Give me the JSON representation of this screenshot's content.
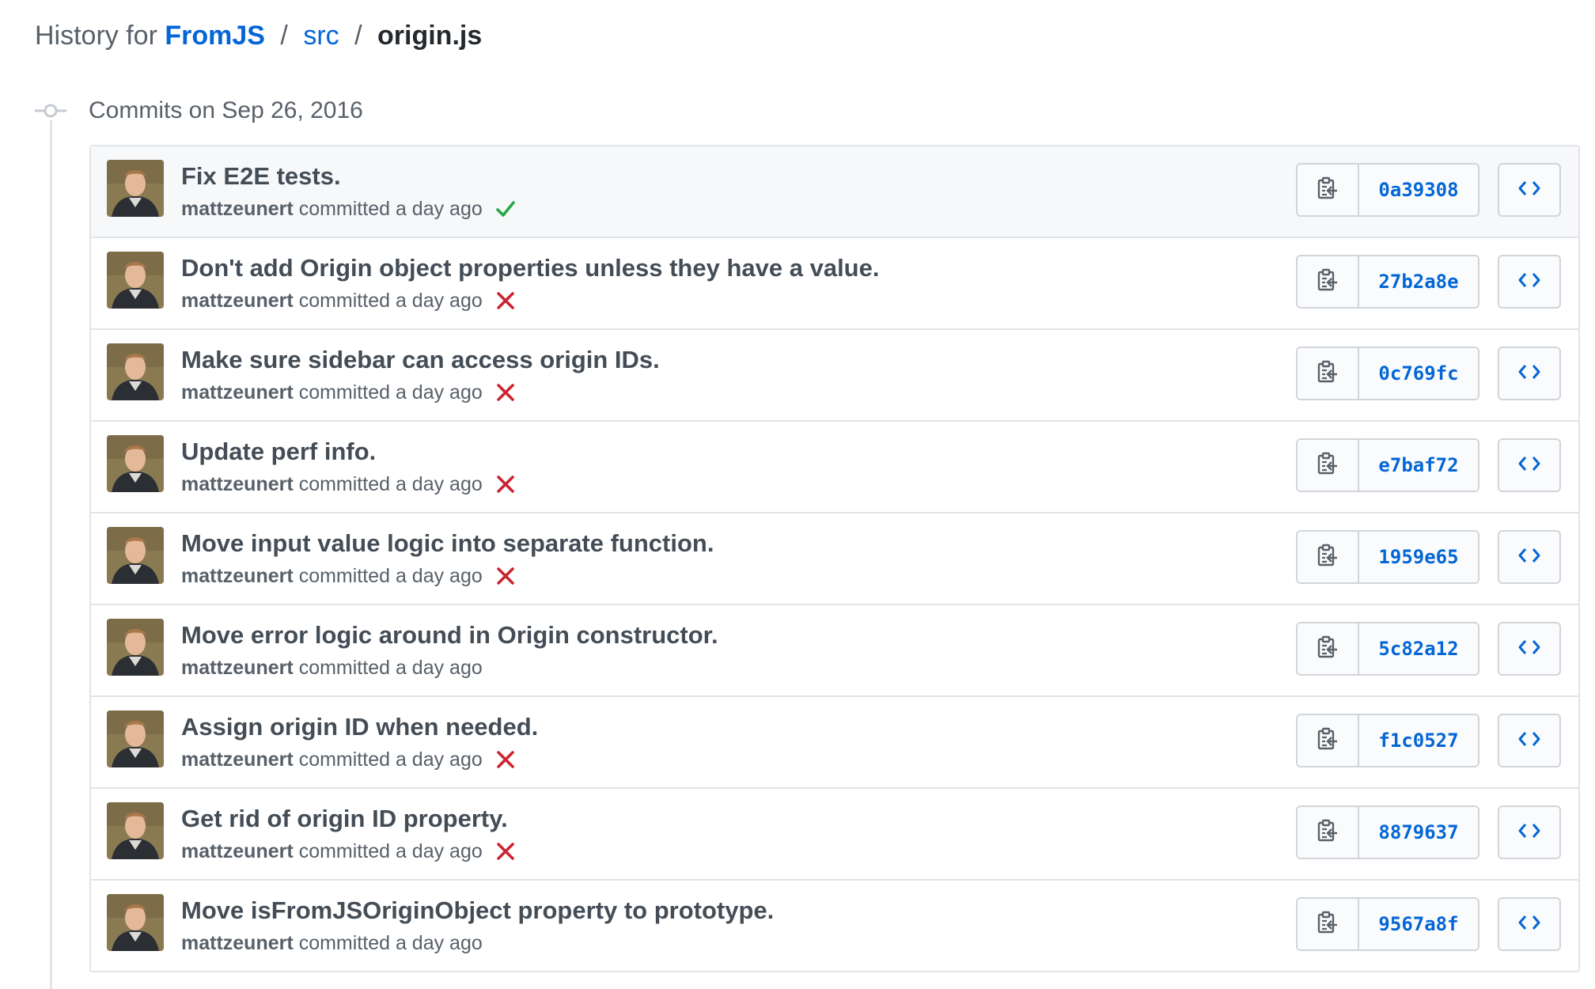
{
  "breadcrumb": {
    "prefix": "History for",
    "repo": "FromJS",
    "separator": "/",
    "directory": "src",
    "file": "origin.js"
  },
  "group": {
    "title": "Commits on Sep 26, 2016"
  },
  "colors": {
    "link": "#0366d6",
    "success": "#28a745",
    "failure": "#cb2431",
    "border": "#e1e4e8"
  },
  "icons": {
    "timeline": "git-commit-icon",
    "copy": "clippy-icon",
    "browse": "code-icon",
    "success": "check-icon",
    "failure": "x-icon"
  },
  "commits": [
    {
      "title": "Fix E2E tests.",
      "author": "mattzeunert",
      "committed": "committed a day ago",
      "status": "success",
      "sha": "0a39308"
    },
    {
      "title": "Don't add Origin object properties unless they have a value.",
      "author": "mattzeunert",
      "committed": "committed a day ago",
      "status": "failure",
      "sha": "27b2a8e"
    },
    {
      "title": "Make sure sidebar can access origin IDs.",
      "author": "mattzeunert",
      "committed": "committed a day ago",
      "status": "failure",
      "sha": "0c769fc"
    },
    {
      "title": "Update perf info.",
      "author": "mattzeunert",
      "committed": "committed a day ago",
      "status": "failure",
      "sha": "e7baf72"
    },
    {
      "title": "Move input value logic into separate function.",
      "author": "mattzeunert",
      "committed": "committed a day ago",
      "status": "failure",
      "sha": "1959e65"
    },
    {
      "title": "Move error logic around in Origin constructor.",
      "author": "mattzeunert",
      "committed": "committed a day ago",
      "status": "none",
      "sha": "5c82a12"
    },
    {
      "title": "Assign origin ID when needed.",
      "author": "mattzeunert",
      "committed": "committed a day ago",
      "status": "failure",
      "sha": "f1c0527"
    },
    {
      "title": "Get rid of origin ID property.",
      "author": "mattzeunert",
      "committed": "committed a day ago",
      "status": "failure",
      "sha": "8879637"
    },
    {
      "title": "Move isFromJSOriginObject property to prototype.",
      "author": "mattzeunert",
      "committed": "committed a day ago",
      "status": "none",
      "sha": "9567a8f"
    }
  ]
}
